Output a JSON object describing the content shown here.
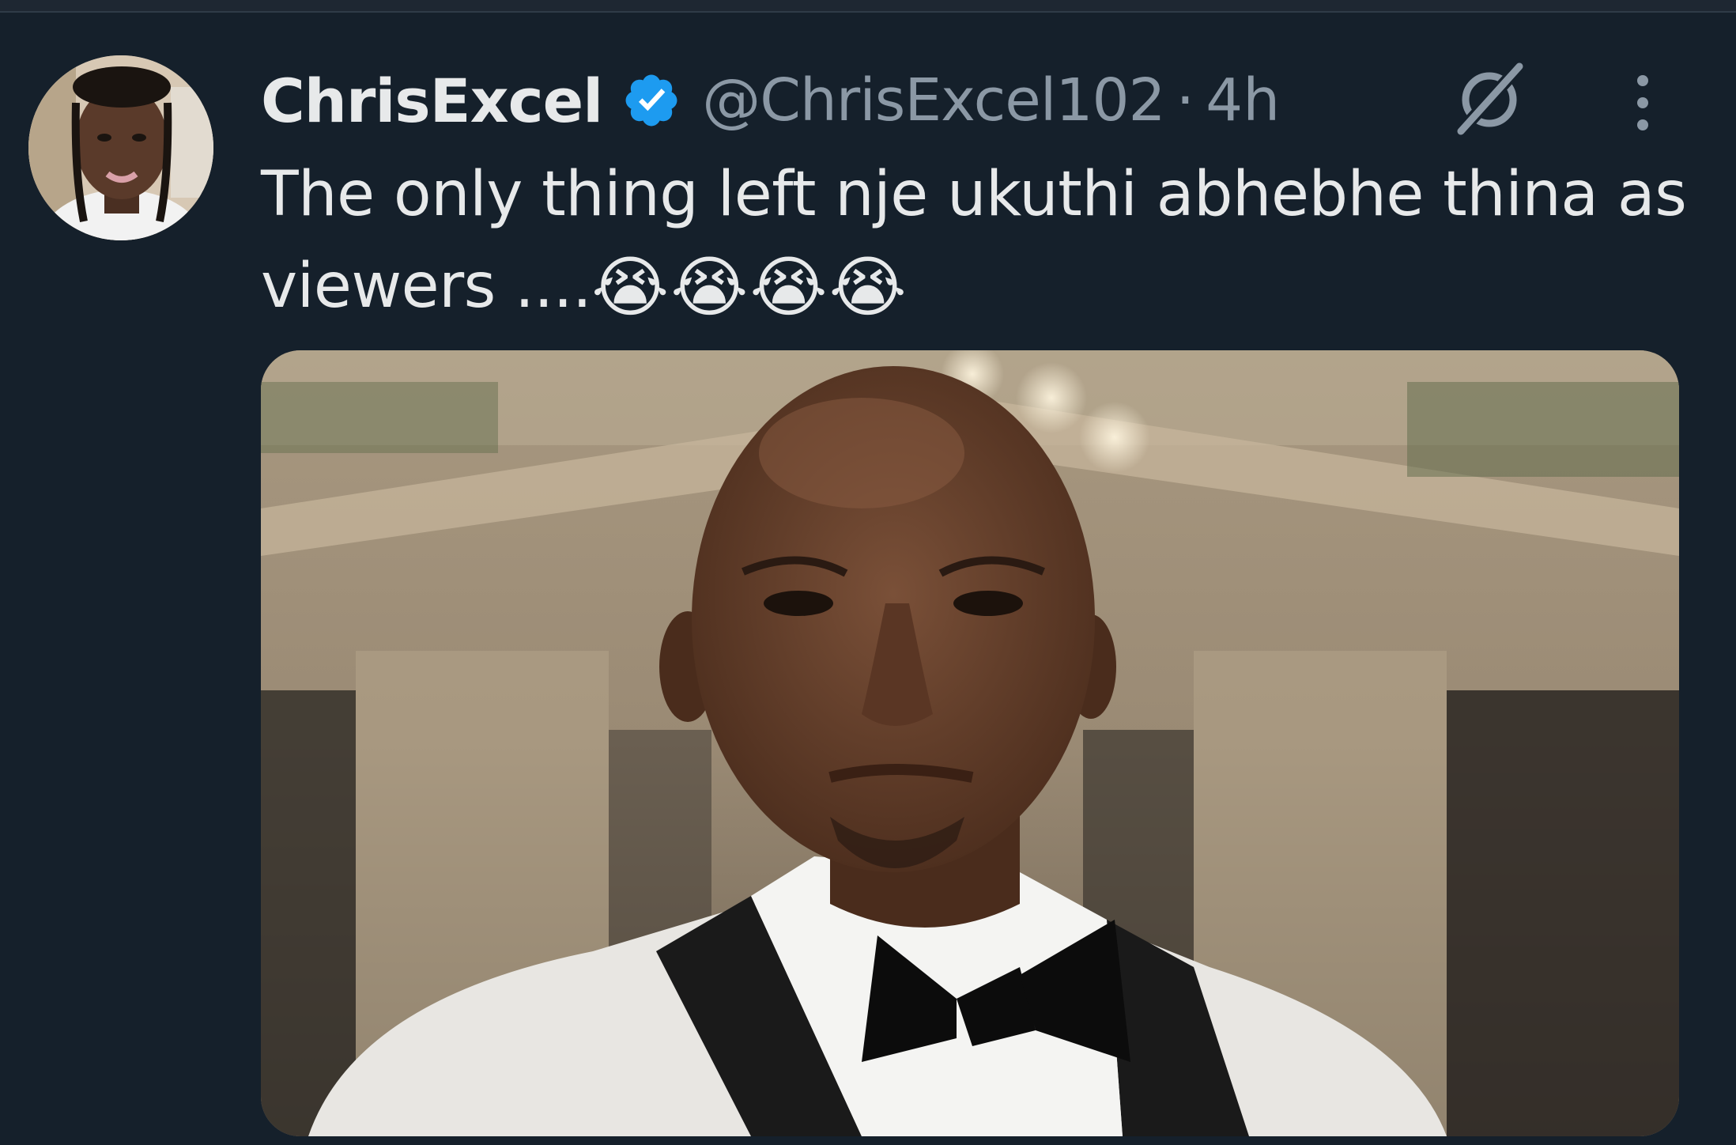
{
  "tweet": {
    "display_name": "ChrisExcel",
    "handle": "@ChrisExcel102",
    "separator": "·",
    "time": "4h",
    "text": "The only thing left nje ukuthi abhebhe thina as viewers ....",
    "emojis": "😭😭😭😭",
    "icons": {
      "verified": "verified-badge-icon",
      "grok": "grok-icon",
      "more": "more-options-icon",
      "verified_color": "#1d9bf0"
    }
  }
}
